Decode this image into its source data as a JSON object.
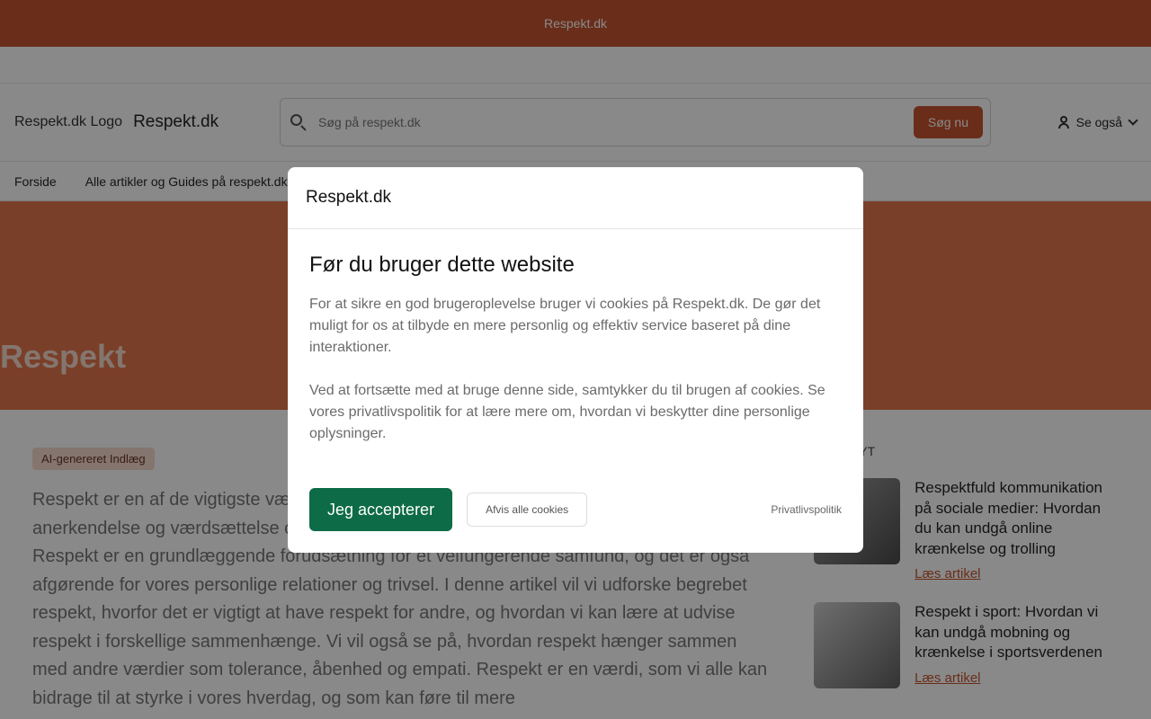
{
  "banner": {
    "text": "Respekt.dk"
  },
  "header": {
    "logo_alt": "Respekt.dk Logo",
    "site_name": "Respekt.dk",
    "search_placeholder": "Søg på respekt.dk",
    "search_button": "Søg nu",
    "see_also": "Se også"
  },
  "nav": {
    "items": [
      {
        "label": "Forside"
      },
      {
        "label": "Alle artikler og Guides på respekt.dk"
      }
    ]
  },
  "hero": {
    "title": "Respekt"
  },
  "article": {
    "badge": "AI-genereret Indlæg",
    "body": "Respekt er en af de vigtigste værdier i vores samfund. Det handler om at vise hensyn, anerkendelse og værdsættelse over for andre mennesker på tværs af kulturer og religioner. Respekt er en grundlæggende forudsætning for et velfungerende samfund, og det er også afgørende for vores personlige relationer og trivsel. I denne artikel vil vi udforske begrebet respekt, hvorfor det er vigtigt at have respekt for andre, og hvordan vi kan lære at udvise respekt i forskellige sammenhænge. Vi vil også se på, hvordan respekt hænger sammen med andre værdier som tolerance, åbenhed og empati. Respekt er en værdi, som vi alle kan bidrage til at styrke i vores hverdag, og som kan føre til mere"
  },
  "sidebar": {
    "heading": "NYT",
    "items": [
      {
        "title": "Respektfuld kommunikation på sociale medier: Hvordan du kan undgå online krænkelse og trolling",
        "link": "Læs artikel"
      },
      {
        "title": "Respekt i sport: Hvordan vi kan undgå mobning og krænkelse i sportsverdenen",
        "link": "Læs artikel"
      }
    ]
  },
  "modal": {
    "header": "Respekt.dk",
    "title": "Før du bruger dette website",
    "paragraph1": "For at sikre en god brugeroplevelse bruger vi cookies på Respekt.dk. De gør det muligt for os at tilbyde en mere personlig og effektiv service baseret på dine interaktioner.",
    "paragraph2": "Ved at fortsætte med at bruge denne side, samtykker du til brugen af cookies. Se vores privatlivspolitik for at lære mere om, hvordan vi beskytter dine personlige oplysninger.",
    "accept": "Jeg accepterer",
    "reject": "Afvis alle cookies",
    "privacy": "Privatlivspolitik"
  },
  "colors": {
    "brand": "#c0461f",
    "hero": "#e06a3d",
    "accept": "#0d6b47"
  }
}
